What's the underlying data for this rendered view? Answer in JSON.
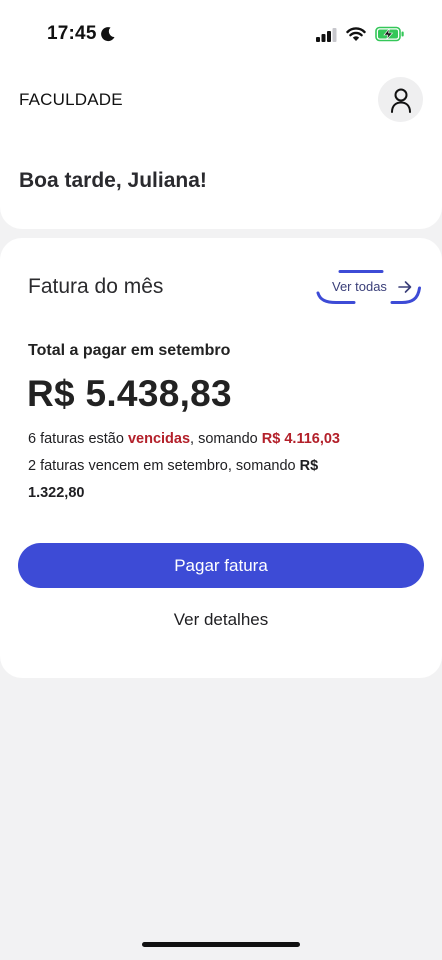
{
  "status_bar": {
    "time": "17:45",
    "icons": [
      "moon-icon",
      "signal-icon",
      "wifi-icon",
      "battery-charging-icon"
    ]
  },
  "header": {
    "app_title": "FACULDADE",
    "avatar_icon": "user-icon",
    "greeting": "Boa tarde, Juliana!"
  },
  "invoice": {
    "card_title": "Fatura do mês",
    "view_all_label": "Ver todas",
    "view_all_icon": "arrow-right-icon",
    "total_label": "Total a pagar em setembro",
    "total_amount": "R$ 5.438,83",
    "overdue": {
      "prefix": "6 faturas estão ",
      "status": "vencidas",
      "middle": ", somando ",
      "amount": "R$ 4.116,03"
    },
    "upcoming": {
      "text": "2 faturas vencem em setembro, somando ",
      "amount_part1": "R$",
      "amount_part2": "1.322,80"
    },
    "pay_button_label": "Pagar fatura",
    "details_label": "Ver detalhes"
  },
  "colors": {
    "accent": "#3d4bd6",
    "danger": "#b3202a",
    "background": "#f2f2f3",
    "battery_charging": "#34c759"
  }
}
